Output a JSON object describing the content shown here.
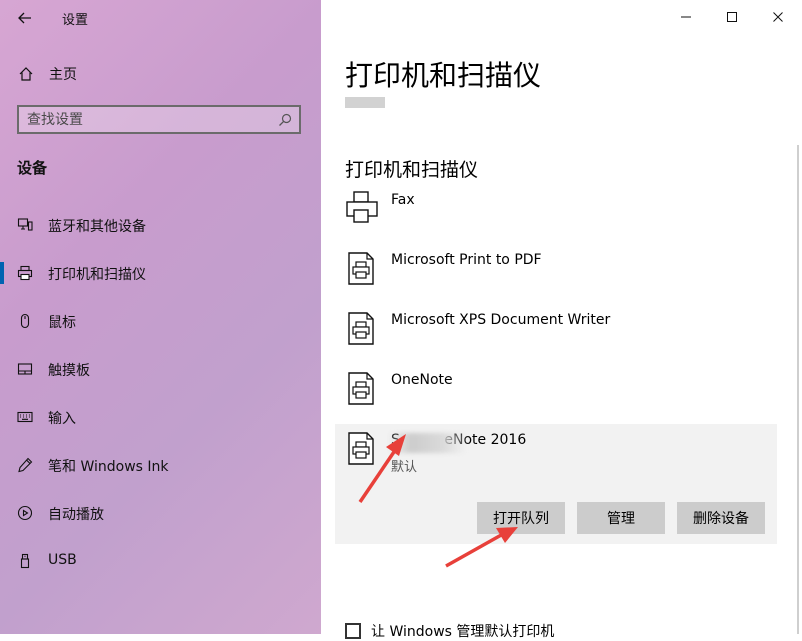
{
  "window": {
    "title": "设置",
    "controls": {
      "minimize": "minimize-icon",
      "maximize": "maximize-icon",
      "close": "close-icon"
    }
  },
  "sidebar": {
    "home_label": "主页",
    "search_placeholder": "查找设置",
    "section_title": "设备",
    "items": [
      {
        "label": "蓝牙和其他设备",
        "icon": "bluetooth-devices-icon",
        "active": false
      },
      {
        "label": "打印机和扫描仪",
        "icon": "printer-icon",
        "active": true
      },
      {
        "label": "鼠标",
        "icon": "mouse-icon",
        "active": false
      },
      {
        "label": "触摸板",
        "icon": "touchpad-icon",
        "active": false
      },
      {
        "label": "输入",
        "icon": "keyboard-icon",
        "active": false
      },
      {
        "label": "笔和 Windows Ink",
        "icon": "pen-icon",
        "active": false
      },
      {
        "label": "自动播放",
        "icon": "autoplay-icon",
        "active": false
      },
      {
        "label": "USB",
        "icon": "usb-icon",
        "active": false
      }
    ]
  },
  "main": {
    "title": "打印机和扫描仪",
    "subtitle": "打印机和扫描仪",
    "printers": [
      {
        "name": "Fax",
        "icon": "fax-icon"
      },
      {
        "name": "Microsoft Print to PDF",
        "icon": "document-printer-icon"
      },
      {
        "name": "Microsoft XPS Document Writer",
        "icon": "document-printer-icon"
      },
      {
        "name": "OneNote",
        "icon": "document-printer-icon"
      }
    ],
    "selected_printer": {
      "name": "S          eNote 2016",
      "status": "默认",
      "icon": "document-printer-icon"
    },
    "actions": {
      "open_queue": "打开队列",
      "manage": "管理",
      "remove": "删除设备"
    },
    "footer_checkbox_label": "让 Windows 管理默认打印机"
  },
  "colors": {
    "accent": "#0063b1",
    "annotation_arrow": "#e8403a",
    "button_bg": "#cccccc",
    "selected_bg": "#f2f2f2"
  }
}
